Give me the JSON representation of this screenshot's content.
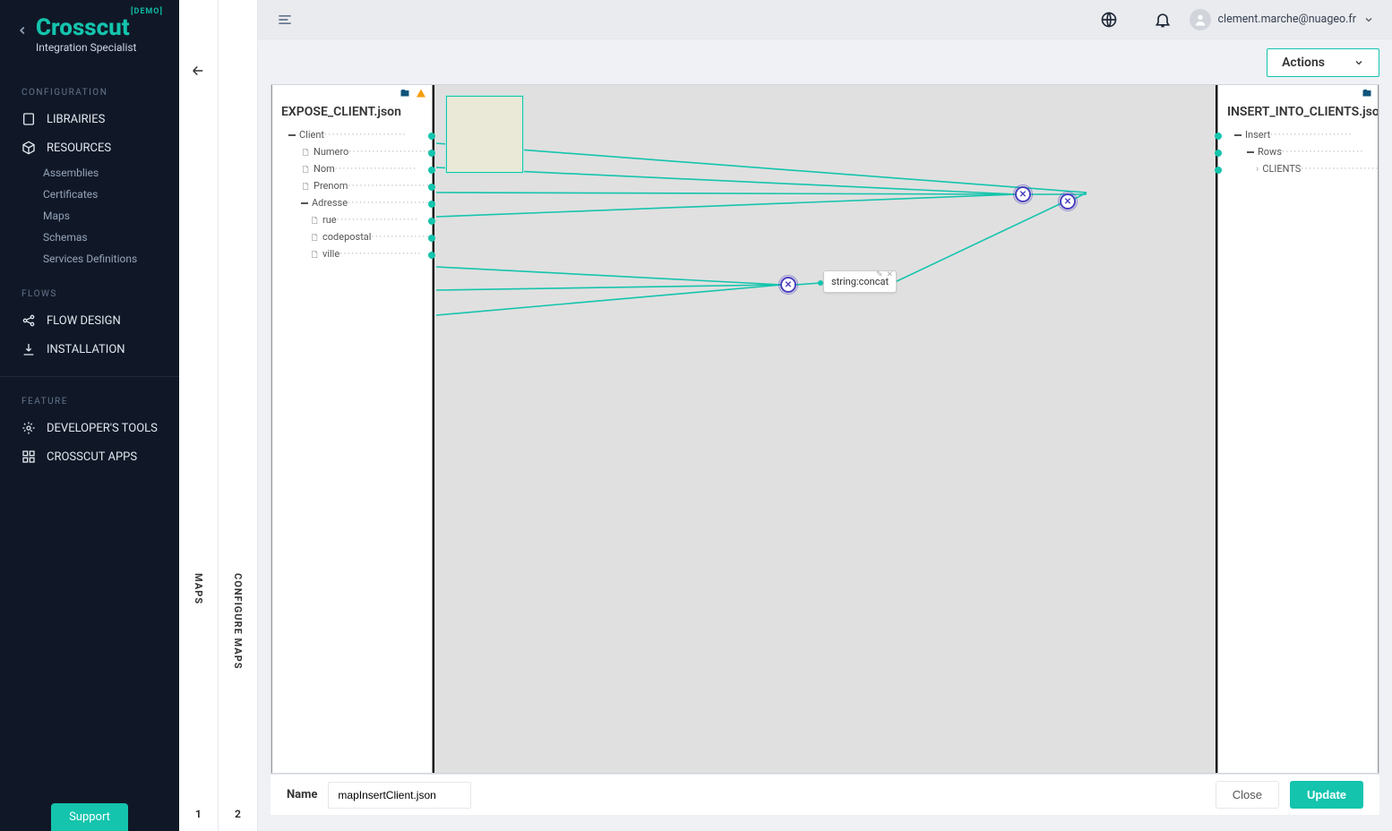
{
  "brand": {
    "demo": "[DEMO]",
    "name": "Crosscut",
    "subtitle": "Integration Specialist"
  },
  "sidebar": {
    "sections": [
      {
        "label": "CONFIGURATION"
      },
      {
        "label": "FLOWS"
      },
      {
        "label": "FEATURE"
      }
    ],
    "librairies": "LIBRAIRIES",
    "resources": "RESOURCES",
    "subs": [
      "Assemblies",
      "Certificates",
      "Maps",
      "Schemas",
      "Services Definitions"
    ],
    "flow_design": "FLOW DESIGN",
    "installation": "INSTALLATION",
    "devtools": "DEVELOPER'S TOOLS",
    "apps": "CROSSCUT APPS",
    "support": "Support"
  },
  "rails": {
    "maps": "MAPS",
    "configure": "CONFIGURE MAPS",
    "n1": "1",
    "n2": "2"
  },
  "topbar": {
    "user": "clement.marche@nuageo.fr"
  },
  "actions": {
    "label": "Actions"
  },
  "source": {
    "title": "EXPOSE_CLIENT.json",
    "tree": [
      {
        "label": "Client",
        "indent": 1,
        "type": "group"
      },
      {
        "label": "Numero",
        "indent": 2,
        "type": "leaf"
      },
      {
        "label": "Nom",
        "indent": 2,
        "type": "leaf"
      },
      {
        "label": "Prenom",
        "indent": 2,
        "type": "leaf"
      },
      {
        "label": "Adresse",
        "indent": 2,
        "type": "group"
      },
      {
        "label": "rue",
        "indent": 3,
        "type": "leaf"
      },
      {
        "label": "codepostal",
        "indent": 3,
        "type": "leaf"
      },
      {
        "label": "ville",
        "indent": 3,
        "type": "leaf"
      }
    ]
  },
  "target": {
    "title": "INSERT_INTO_CLIENTS.json",
    "tree": [
      {
        "label": "Insert",
        "indent": 1,
        "type": "group"
      },
      {
        "label": "Rows",
        "indent": 2,
        "type": "group"
      },
      {
        "label": "CLIENTS",
        "indent": 3,
        "type": "ref"
      }
    ]
  },
  "fn": {
    "label": "string:concat"
  },
  "footer": {
    "name_label": "Name",
    "name_value": "mapInsertClient.json",
    "close": "Close",
    "update": "Update"
  }
}
